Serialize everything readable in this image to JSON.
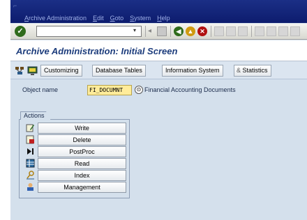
{
  "menubar": {
    "items": [
      {
        "label": "Archive Administration"
      },
      {
        "label": "Edit"
      },
      {
        "label": "Goto"
      },
      {
        "label": "System"
      },
      {
        "label": "Help"
      }
    ]
  },
  "system_toolbar": {
    "command_field": {
      "value": "",
      "placeholder": ""
    },
    "icons": [
      "enter-icon",
      "save-icon",
      "back-icon",
      "exit-icon",
      "cancel-icon",
      "print-icon",
      "find-icon",
      "find-next-icon",
      "first-page-icon",
      "previous-page-icon",
      "next-page-icon",
      "last-page-icon"
    ]
  },
  "page_title": "Archive Administration: Initial Screen",
  "app_toolbar": {
    "customizing": "Customizing",
    "database_tables": "Database Tables",
    "information_system": "Information System",
    "statistics": "Statistics"
  },
  "object": {
    "label": "Object name",
    "value": "FI_DOCUMNT",
    "description": "Financial Accounting Documents"
  },
  "actions": {
    "title": "Actions",
    "buttons": [
      {
        "label": "Write",
        "icon": "write-icon"
      },
      {
        "label": "Delete",
        "icon": "delete-icon"
      },
      {
        "label": "PostProc",
        "icon": "postproc-icon"
      },
      {
        "label": "Read",
        "icon": "read-icon"
      },
      {
        "label": "Index",
        "icon": "index-icon"
      },
      {
        "label": "Management",
        "icon": "management-icon"
      }
    ]
  },
  "colors": {
    "menubar": "#0d1c6e",
    "background": "#d4e0ec",
    "title": "#1c3c7c",
    "field_highlight": "#ffec9a"
  }
}
